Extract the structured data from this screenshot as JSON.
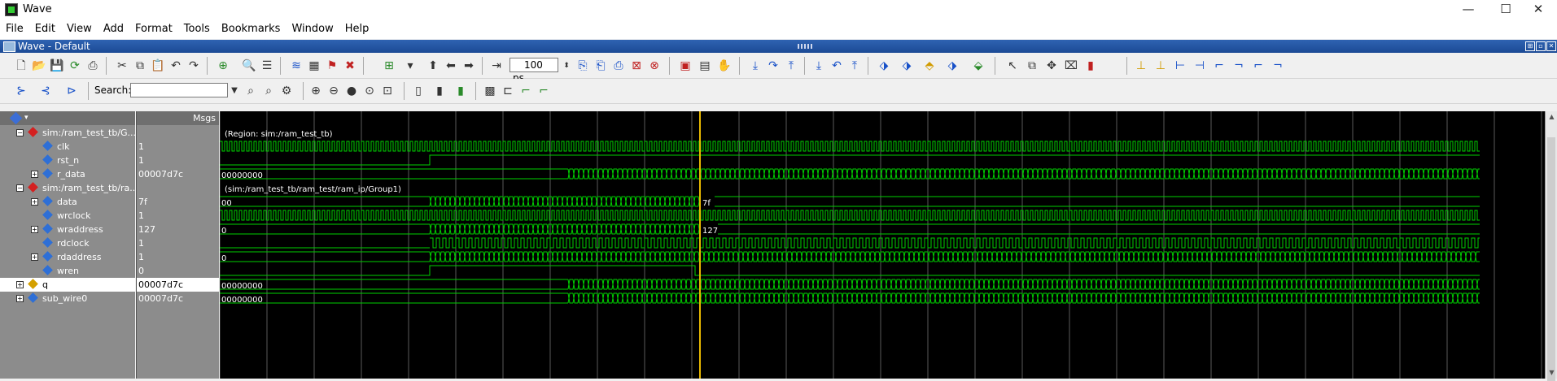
{
  "window": {
    "title": "Wave",
    "min": "—",
    "max": "☐",
    "close": "✕"
  },
  "menu": [
    "File",
    "Edit",
    "View",
    "Add",
    "Format",
    "Tools",
    "Bookmarks",
    "Window",
    "Help"
  ],
  "panel": {
    "title": "Wave - Default"
  },
  "toolbar": {
    "time_value": "100",
    "time_unit": "ps",
    "search_label": "Search:",
    "search_value": ""
  },
  "headers": {
    "msgs": "Msgs"
  },
  "signals": [
    {
      "name": "sim:/ram_test_tb/G...",
      "value": "",
      "kind": "group",
      "indent": 0,
      "expand": "−"
    },
    {
      "name": "clk",
      "value": "1",
      "kind": "wire",
      "indent": 1,
      "expand": ""
    },
    {
      "name": "rst_n",
      "value": "1",
      "kind": "wire",
      "indent": 1,
      "expand": ""
    },
    {
      "name": "r_data",
      "value": "00007d7c",
      "kind": "bus",
      "indent": 1,
      "expand": "+"
    },
    {
      "name": "sim:/ram_test_tb/ra...",
      "value": "",
      "kind": "group",
      "indent": 0,
      "expand": "−"
    },
    {
      "name": "data",
      "value": "7f",
      "kind": "bus",
      "indent": 1,
      "expand": "+"
    },
    {
      "name": "wrclock",
      "value": "1",
      "kind": "wire",
      "indent": 1,
      "expand": ""
    },
    {
      "name": "wraddress",
      "value": "127",
      "kind": "bus",
      "indent": 1,
      "expand": "+"
    },
    {
      "name": "rdclock",
      "value": "1",
      "kind": "wire",
      "indent": 1,
      "expand": ""
    },
    {
      "name": "rdaddress",
      "value": "1",
      "kind": "bus",
      "indent": 1,
      "expand": "+"
    },
    {
      "name": "wren",
      "value": "0",
      "kind": "wire",
      "indent": 1,
      "expand": ""
    },
    {
      "name": "q",
      "value": "00007d7c",
      "kind": "bus2",
      "indent": 0,
      "expand": "+",
      "selected": true
    },
    {
      "name": "sub_wire0",
      "value": "00007d7c",
      "kind": "bus",
      "indent": 0,
      "expand": "+"
    }
  ],
  "wave_labels": {
    "region1": "(Region: sim:/ram_test_tb)",
    "region2": "(sim:/ram_test_tb/ram_test/ram_ip/Group1)",
    "r_data_init": "00000000",
    "data_init": "00",
    "data_cursor": "7f",
    "wraddress_init": "0",
    "wraddress_cursor": "127",
    "rdaddress_init": "0",
    "q_init": "00000000",
    "sub_wire0_init": "00000000"
  },
  "colors": {
    "wave": "#00d000",
    "cursor": "#e8b800",
    "grid": "#5a5a5a",
    "bg": "#000000"
  }
}
